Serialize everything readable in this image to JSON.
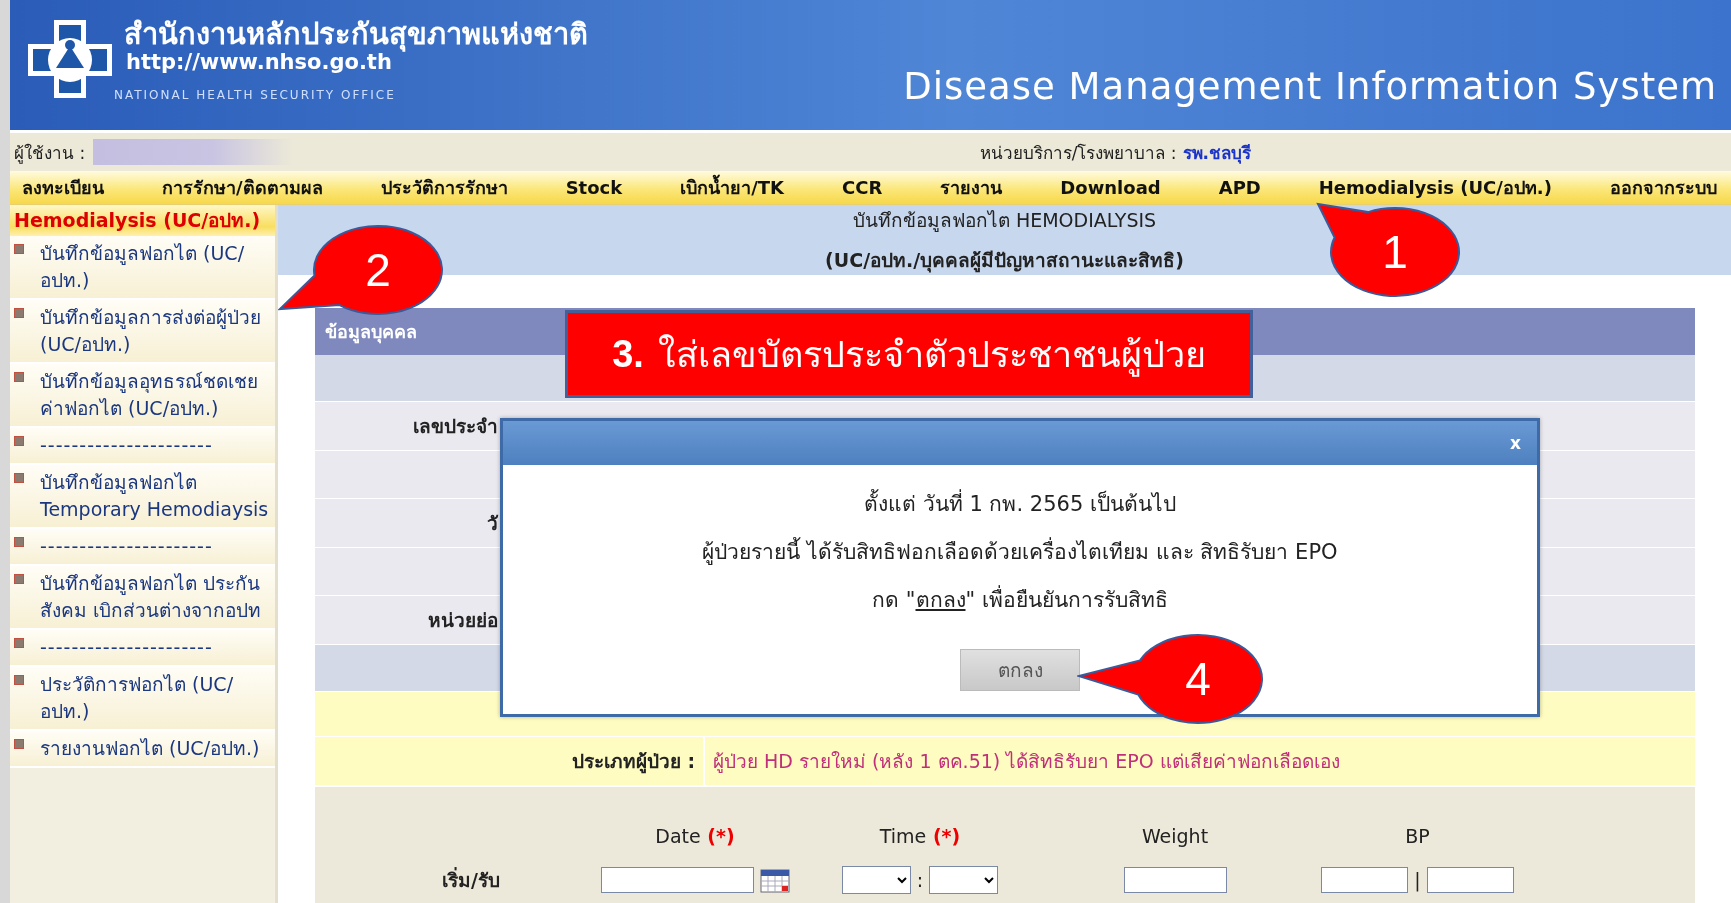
{
  "header": {
    "title": "สำนักงานหลักประกันสุขภาพแห่งชาติ",
    "url": "http://www.nhso.go.th",
    "org": "NATIONAL HEALTH SECURITY OFFICE",
    "system_title": "Disease Management Information System"
  },
  "user_bar": {
    "user_label": "ผู้ใช้งาน :",
    "unit_label": "หน่วยบริการ/โรงพยาบาล :",
    "unit_value": "รพ.ชลบุรี"
  },
  "menu": [
    "ลงทะเบียน",
    "การรักษา/ติดตามผล",
    "ประวัติการรักษา",
    "Stock",
    "เบิกน้ำยา/TK",
    "CCR",
    "รายงาน",
    "Download",
    "APD",
    "Hemodialysis (UC/อปท.)",
    "ออกจากระบบ"
  ],
  "sidebar": {
    "heading": "Hemodialysis (UC/อปท.)",
    "items": [
      {
        "kind": "link",
        "label": "บันทึกข้อมูลฟอกไต (UC/อปท.)"
      },
      {
        "kind": "link",
        "label": "บันทึกข้อมูลการส่งต่อผู้ป่วย (UC/อปท.)"
      },
      {
        "kind": "link",
        "label": "บันทึกข้อมูลอุทธรณ์ชดเชยค่าฟอกไต (UC/อปท.)"
      },
      {
        "kind": "separator",
        "label": "----------------------"
      },
      {
        "kind": "link",
        "label": "บันทึกข้อมูลฟอกไต Temporary Hemodiaysis"
      },
      {
        "kind": "separator",
        "label": "----------------------"
      },
      {
        "kind": "link",
        "label": "บันทึกข้อมูลฟอกไต ประกันสังคม เบิกส่วนต่างจากอปท"
      },
      {
        "kind": "separator",
        "label": "----------------------"
      },
      {
        "kind": "link",
        "label": "ประวัติการฟอกไต (UC/อปท.)"
      },
      {
        "kind": "link",
        "label": "รายงานฟอกไต (UC/อปท.)"
      }
    ]
  },
  "page_title": [
    "บันทึกข้อมูลฟอกไต HEMODIALYSIS",
    "(UC/อปท./บุคคลผู้มีปัญหาสถานะและสิทธิ)"
  ],
  "section": {
    "header": "ข้อมูลบุคคล",
    "rows": [
      {
        "kind": "band"
      },
      {
        "kind": "field",
        "label": "เลขประจำ"
      },
      {
        "kind": "blank"
      },
      {
        "kind": "field",
        "label": "วั"
      },
      {
        "kind": "blank"
      },
      {
        "kind": "field",
        "label": "หน่วยย่อ"
      },
      {
        "kind": "band"
      },
      {
        "kind": "yellow"
      }
    ],
    "patient_type": {
      "label": "ประเภทผู้ป่วย :",
      "value": "ผู้ป่วย HD รายใหม่ (หลัง 1 ตค.51) ได้สิทธิรับยา EPO แต่เสียค่าฟอกเลือดเอง"
    },
    "vitals": {
      "columns": [
        {
          "label": "Date",
          "required": "(*)"
        },
        {
          "label": "Time",
          "required": "(*)"
        },
        {
          "label": "Weight"
        },
        {
          "label": "BP"
        }
      ],
      "row_label": "เริ่ม/รับ",
      "time_separator": ":",
      "bp_separator": "|"
    }
  },
  "dialog": {
    "close": "x",
    "lines": [
      "ตั้งแต่ วันที่ 1 กพ. 2565 เป็นต้นไป",
      "ผู้ป่วยรายนี้ ได้รับสิทธิฟอกเลือดด้วยเครื่องไตเทียม และ สิทธิรับยา EPO"
    ],
    "confirm_line": {
      "before": "กด \"",
      "link": "ตกลง",
      "after": "\" เพื่อยืนยันการรับสิทธิ"
    },
    "button": "ตกลง"
  },
  "annotations": [
    {
      "kind": "callout",
      "label": "1"
    },
    {
      "kind": "callout",
      "label": "2"
    },
    {
      "kind": "banner",
      "number": "3.",
      "text": "ใส่เลขบัตรประจำตัวประชาชนผู้ป่วย"
    },
    {
      "kind": "callout",
      "label": "4"
    }
  ]
}
